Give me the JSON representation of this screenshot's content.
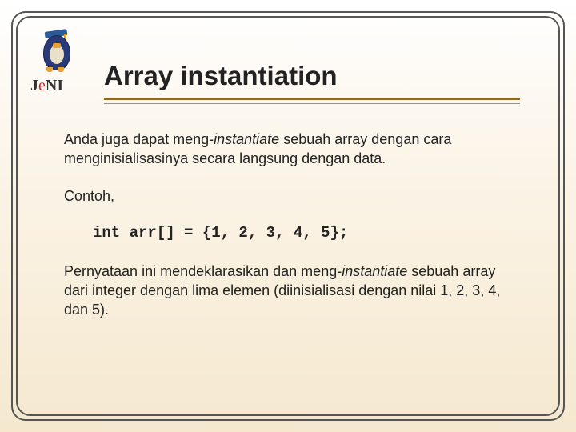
{
  "logo": {
    "text_part1": "J",
    "text_part2": "e",
    "text_part3": "NI"
  },
  "title": "Array instantiation",
  "para1": {
    "pre": "Anda juga dapat meng-",
    "italic": "instantiate",
    "post": " sebuah array dengan cara menginisialisasinya secara langsung dengan data."
  },
  "para2": "Contoh,",
  "code_line": "int arr[] = {1, 2, 3, 4, 5};",
  "para3": {
    "pre": "Pernyataan ini mendeklarasikan dan meng-",
    "italic": "instantiate",
    "post": " sebuah array dari integer dengan lima elemen (diinisialisasi dengan nilai 1, 2, 3, 4, dan 5)."
  }
}
